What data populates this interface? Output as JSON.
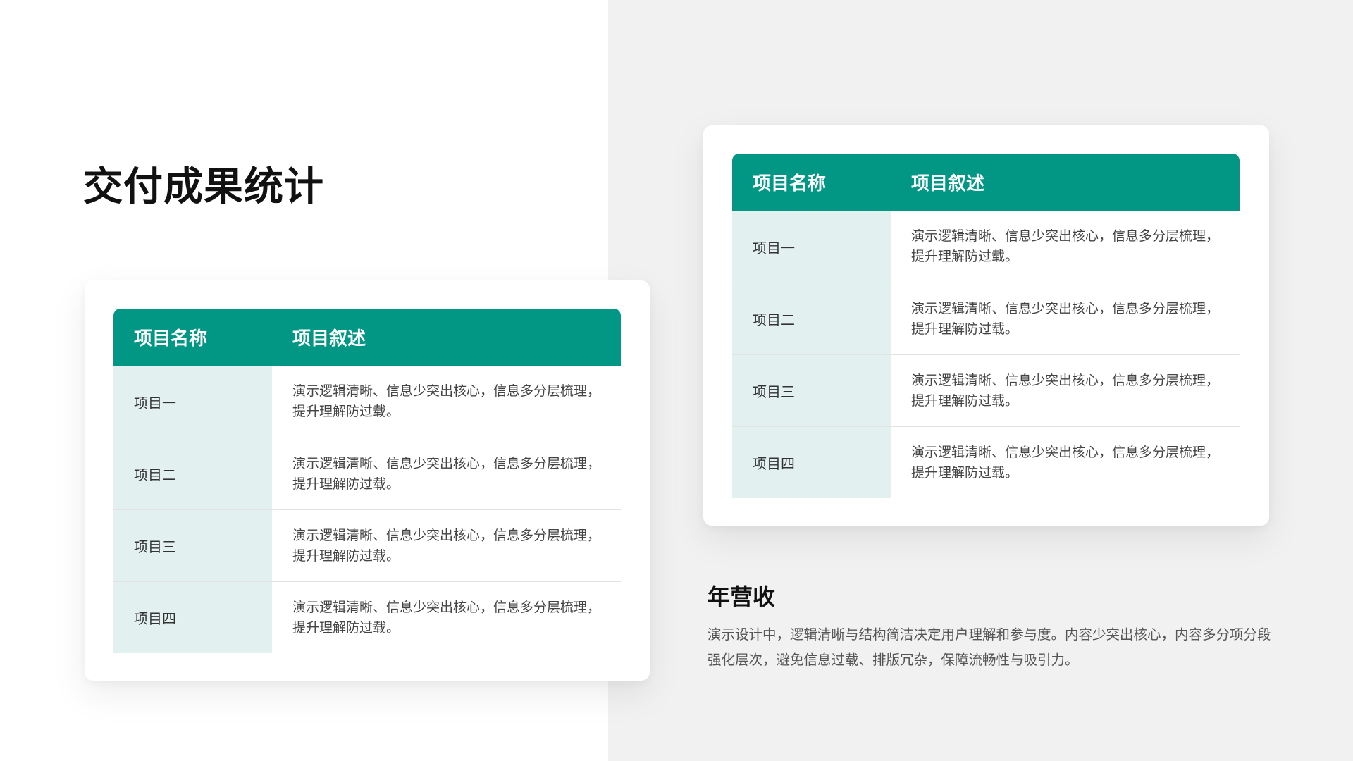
{
  "page": {
    "title": "交付成果统计"
  },
  "colors": {
    "accent": "#019784",
    "name_cell_bg": "#e2f1f0",
    "right_panel_bg": "#f1f1f1"
  },
  "table_left": {
    "header": {
      "name": "项目名称",
      "description": "项目叙述"
    },
    "rows": [
      {
        "name": "项目一",
        "description": "演示逻辑清晰、信息少突出核心，信息多分层梳理，提升理解防过载。"
      },
      {
        "name": "项目二",
        "description": "演示逻辑清晰、信息少突出核心，信息多分层梳理，提升理解防过载。"
      },
      {
        "name": "项目三",
        "description": "演示逻辑清晰、信息少突出核心，信息多分层梳理，提升理解防过载。"
      },
      {
        "name": "项目四",
        "description": "演示逻辑清晰、信息少突出核心，信息多分层梳理，提升理解防过载。"
      }
    ]
  },
  "table_right": {
    "header": {
      "name": "项目名称",
      "description": "项目叙述"
    },
    "rows": [
      {
        "name": "项目一",
        "description": "演示逻辑清晰、信息少突出核心，信息多分层梳理，提升理解防过载。"
      },
      {
        "name": "项目二",
        "description": "演示逻辑清晰、信息少突出核心，信息多分层梳理，提升理解防过载。"
      },
      {
        "name": "项目三",
        "description": "演示逻辑清晰、信息少突出核心，信息多分层梳理，提升理解防过载。"
      },
      {
        "name": "项目四",
        "description": "演示逻辑清晰、信息少突出核心，信息多分层梳理，提升理解防过载。"
      }
    ]
  },
  "revenue_section": {
    "title": "年营收",
    "body": "演示设计中，逻辑清晰与结构简洁决定用户理解和参与度。内容少突出核心，内容多分项分段强化层次，避免信息过载、排版冗杂，保障流畅性与吸引力。"
  }
}
